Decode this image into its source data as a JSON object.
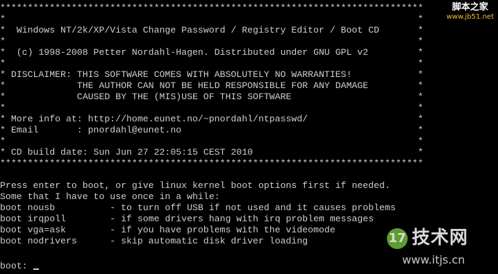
{
  "watermark_top": {
    "site_name": "脚本之家",
    "url": "www.jb51.net"
  },
  "watermark_bottom": {
    "logo_text": "17",
    "site_name": "技术网",
    "url": "www.itjs.cn"
  },
  "console": {
    "lines": [
      "*****************************************************************************",
      "*                                                                           *",
      "*  Windows NT/2k/XP/Vista Change Password / Registry Editor / Boot CD       *",
      "*                                                                           *",
      "*  (c) 1998-2008 Petter Nordahl-Hagen. Distributed under GNU GPL v2         *",
      "*                                                                           *",
      "* DISCLAIMER: THIS SOFTWARE COMES WITH ABSOLUTELY NO WARRANTIES!            *",
      "*             THE AUTHOR CAN NOT BE HELD RESPONSIBLE FOR ANY DAMAGE         *",
      "*             CAUSED BY THE (MIS)USE OF THIS SOFTWARE                       *",
      "*                                                                           *",
      "* More info at: http://home.eunet.no/~pnordahl/ntpasswd/                    *",
      "* Email       : pnordahl@eunet.no                                           *",
      "*                                                                           *",
      "* CD build date: Sun Jun 27 22:05:15 CEST 2010                              *",
      "*****************************************************************************",
      "",
      "Press enter to boot, or give linux kernel boot options first if needed.",
      "Some that I have to use once in a while:",
      "boot nousb          - to turn off USB if not used and it causes problems",
      "boot irqpoll        - if some drivers hang with irq problem messages",
      "boot vga=ask        - if you have problems with the videomode",
      "boot nodrivers      - skip automatic disk driver loading",
      "",
      "boot: "
    ]
  }
}
